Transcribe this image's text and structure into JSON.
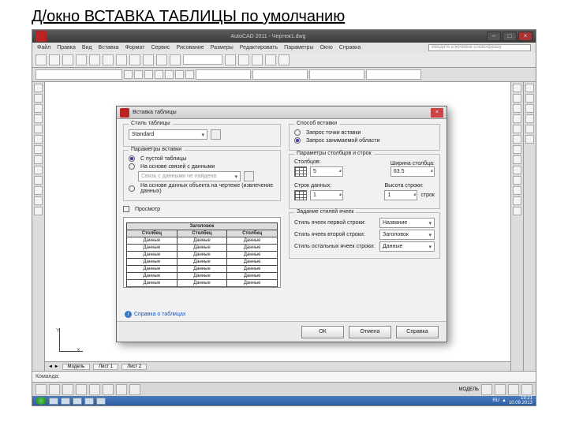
{
  "slide": {
    "title": "Д/окно ВСТАВКА ТАБЛИЦЫ по умолчанию"
  },
  "app": {
    "title": "AutoCAD 2011 - Чертеж1.dwg",
    "search_placeholder": "Введите ключевое слово/фразу",
    "menu": [
      "Файл",
      "Правка",
      "Вид",
      "Вставка",
      "Формат",
      "Сервис",
      "Рисование",
      "Размеры",
      "Редактировать",
      "Параметры",
      "Окно",
      "Справка"
    ],
    "tabs": {
      "model": "Модель",
      "layout1": "Лист 1",
      "layout2": "Лист 2"
    },
    "cmd_prompt": "Команда:",
    "status_label": "МОДЕЛЬ",
    "tray": {
      "lang": "RU",
      "time": "19:21",
      "date": "10.09.2013"
    }
  },
  "dialog": {
    "title": "Вставка таблицы",
    "style": {
      "group": "Стиль таблицы",
      "value": "Standard"
    },
    "params": {
      "group": "Параметры вставки",
      "opt1": "С пустой таблицы",
      "opt2": "На основе связей с данными",
      "no_link": "Связь с данными не найдена",
      "opt3": "На основе данных объекта на чертеже (извлечение данных)"
    },
    "preview": {
      "chk": "Просмотр",
      "header": "Заголовок",
      "colA": "Столбец",
      "colB": "Столбец",
      "colC": "Столбец",
      "cell": "Данные"
    },
    "mode": {
      "group": "Способ вставки",
      "opt1": "Запрос точки вставки",
      "opt2": "Запрос занимаемой области"
    },
    "cols": {
      "group": "Параметры столбцов и строк",
      "col_label": "Столбцов:",
      "col_val": "5",
      "colw_label": "Ширина столбца:",
      "colw_val": "63.5",
      "row_label": "Строк данных:",
      "row_val": "1",
      "rowh_label": "Высота строки:",
      "rowh_val": "1",
      "rowh_unit": "строк"
    },
    "cellstyles": {
      "group": "Задание стилей ячеек",
      "r1_label": "Стиль ячеек первой строки:",
      "r1_val": "Название",
      "r2_label": "Стиль ячеек второй строки:",
      "r2_val": "Заголовок",
      "r3_label": "Стиль остальных ячеек строки:",
      "r3_val": "Данные"
    },
    "link": "Справка о таблицах",
    "buttons": {
      "ok": "ОК",
      "cancel": "Отмена",
      "help": "Справка"
    }
  }
}
